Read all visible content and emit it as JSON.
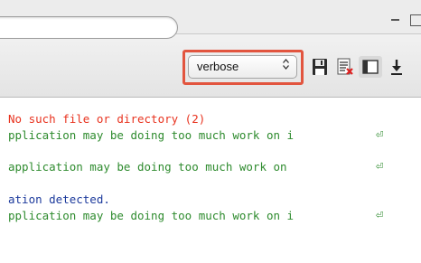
{
  "toolbar": {
    "log_level_select": {
      "value": "verbose",
      "options_arrow": "⌃⌄"
    },
    "icons": [
      "save-icon",
      "clear-log-icon",
      "layout-toggle-icon",
      "scroll-down-icon"
    ]
  },
  "colors": {
    "error": "#e8321e",
    "warning": "#2e8b2e",
    "debug": "#1c3a9c",
    "highlight_border": "#e2553f"
  },
  "log": {
    "lines": [
      {
        "text": "No such file or directory (2)",
        "level": "error"
      },
      {
        "text": "pplication may be doing too much work on i",
        "level": "warning",
        "wrapped": true
      },
      {
        "text": "application may be doing too much work on ",
        "level": "warning",
        "wrapped": true
      },
      {
        "text": "ation detected.",
        "level": "debug"
      },
      {
        "text": "pplication may be doing too much work on i",
        "level": "warning",
        "wrapped": true
      }
    ],
    "wrap_glyph": "⏎"
  }
}
